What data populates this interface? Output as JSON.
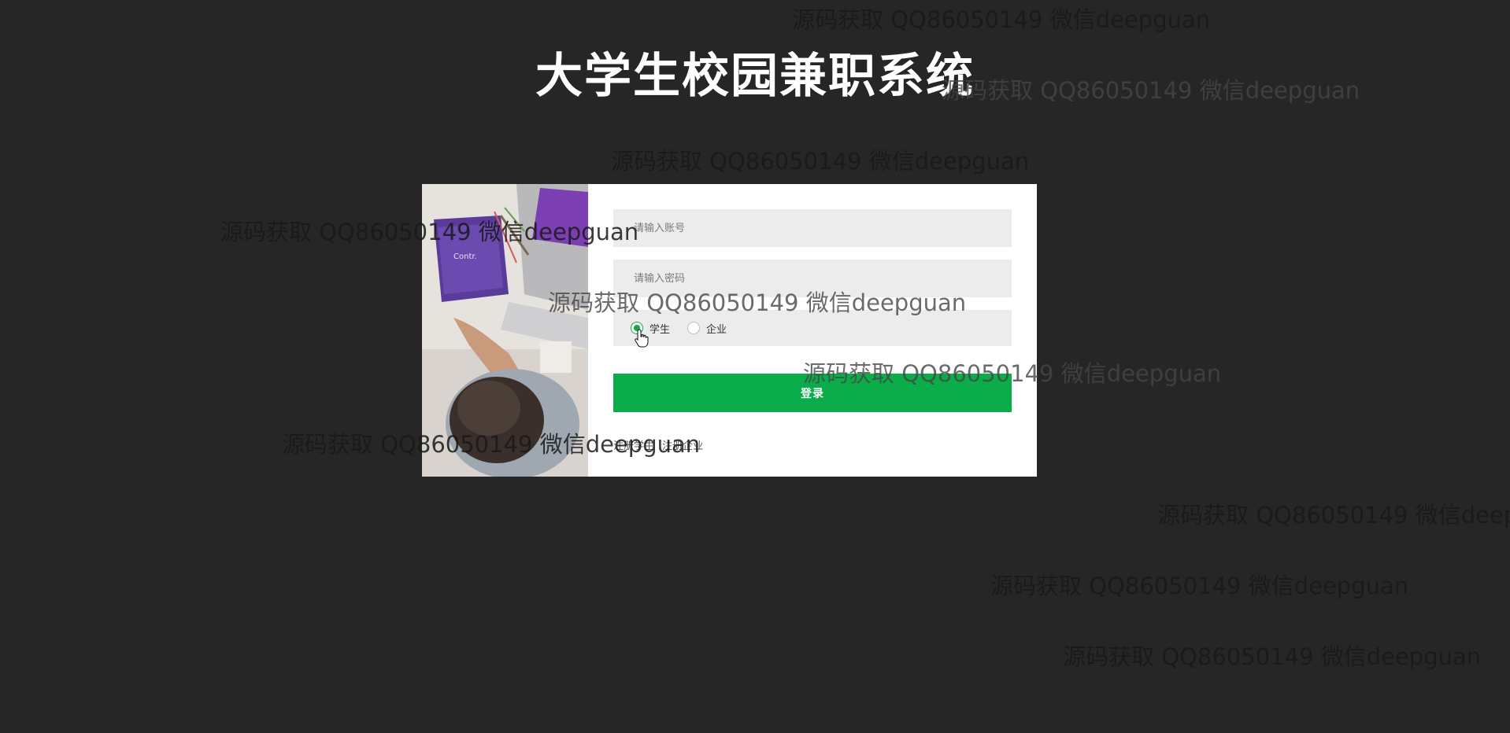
{
  "header": {
    "title": "大学生校园兼职系统"
  },
  "login": {
    "account_placeholder": "请输入账号",
    "password_placeholder": "请输入密码",
    "roles": [
      {
        "label": "学生",
        "selected": true
      },
      {
        "label": "企业",
        "selected": false
      }
    ],
    "submit_label": "登录",
    "register_student_label": "注册学生",
    "register_company_label": "注册企业"
  },
  "watermark": {
    "text": "源码获取 QQ86050149 微信deepguan"
  },
  "colors": {
    "background": "#262626",
    "accent": "#0aad4a",
    "card": "#ffffff",
    "field": "#ececec"
  },
  "icons": {
    "pointer": "hand-pointer-icon"
  }
}
